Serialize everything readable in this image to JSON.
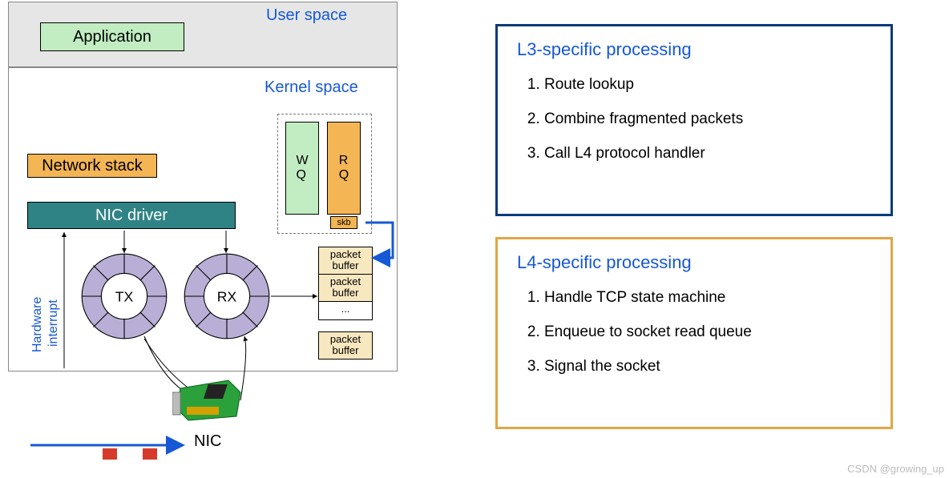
{
  "left": {
    "user_space": "User space",
    "application": "Application",
    "kernel_space": "Kernel space",
    "network_stack": "Network stack",
    "nic_driver": "NIC driver",
    "hw_interrupt": "Hardware",
    "hw_interrupt2": "interrupt",
    "wq": "W\nQ",
    "rq": "R\nQ",
    "skb": "skb",
    "tx": "TX",
    "rx": "RX",
    "pb1": "packet\nbuffer",
    "pb2": "packet\nbuffer",
    "pb3": "...",
    "pb4": "packet\nbuffer",
    "nic": "NIC"
  },
  "l3": {
    "title": "L3-specific  processing",
    "items": [
      "Route lookup",
      "Combine fragmented packets",
      "Call L4 protocol handler"
    ]
  },
  "l4": {
    "title": "L4-specific processing",
    "items": [
      "Handle TCP state machine",
      "Enqueue to socket read queue",
      "Signal the socket"
    ]
  },
  "watermark": "CSDN @growing_up"
}
